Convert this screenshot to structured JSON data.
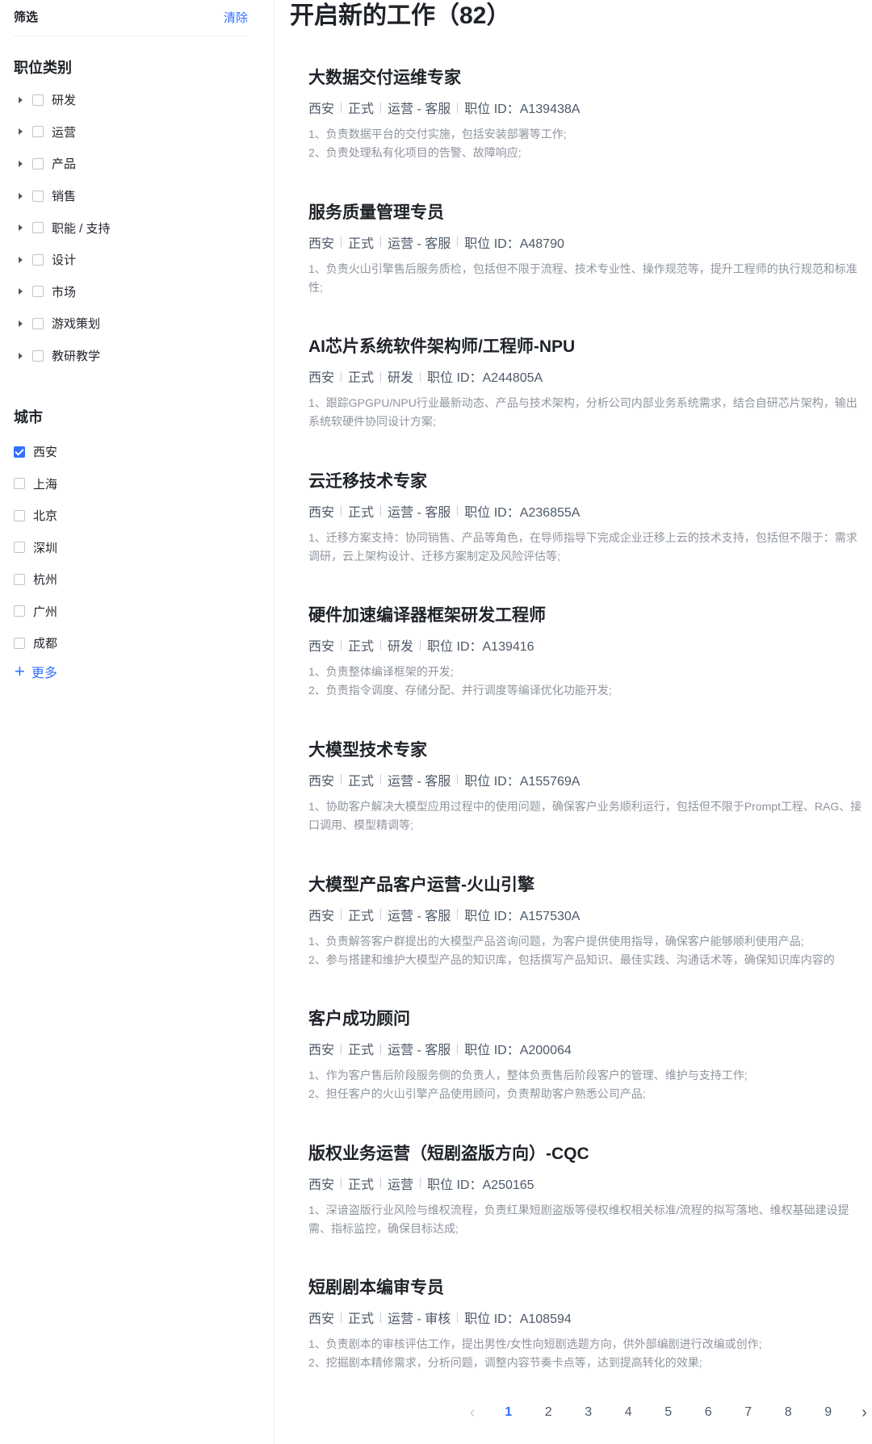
{
  "filter": {
    "title": "筛选",
    "clear": "清除"
  },
  "category": {
    "title": "职位类别",
    "items": [
      {
        "label": "研发"
      },
      {
        "label": "运营"
      },
      {
        "label": "产品"
      },
      {
        "label": "销售"
      },
      {
        "label": "职能 / 支持"
      },
      {
        "label": "设计"
      },
      {
        "label": "市场"
      },
      {
        "label": "游戏策划"
      },
      {
        "label": "教研教学"
      }
    ]
  },
  "city": {
    "title": "城市",
    "items": [
      {
        "label": "西安",
        "checked": true
      },
      {
        "label": "上海",
        "checked": false
      },
      {
        "label": "北京",
        "checked": false
      },
      {
        "label": "深圳",
        "checked": false
      },
      {
        "label": "杭州",
        "checked": false
      },
      {
        "label": "广州",
        "checked": false
      },
      {
        "label": "成都",
        "checked": false
      }
    ],
    "more": "更多"
  },
  "main": {
    "title": "开启新的工作（82）",
    "jobs": [
      {
        "title": "大数据交付运维专家",
        "meta": [
          "西安",
          "正式",
          "运营 - 客服",
          "职位 ID：A139438A"
        ],
        "desc": "1、负责数据平台的交付实施，包括安装部署等工作;\n2、负责处理私有化项目的告警、故障响应;"
      },
      {
        "title": "服务质量管理专员",
        "meta": [
          "西安",
          "正式",
          "运营 - 客服",
          "职位 ID：A48790"
        ],
        "desc": "1、负责火山引擎售后服务质检，包括但不限于流程、技术专业性、操作规范等，提升工程师的执行规范和标准性;"
      },
      {
        "title": "AI芯片系统软件架构师/工程师-NPU",
        "meta": [
          "西安",
          "正式",
          "研发",
          "职位 ID：A244805A"
        ],
        "desc": "1、跟踪GPGPU/NPU行业最新动态、产品与技术架构，分析公司内部业务系统需求，结合自研芯片架构，输出系统软硬件协同设计方案;"
      },
      {
        "title": "云迁移技术专家",
        "meta": [
          "西安",
          "正式",
          "运营 - 客服",
          "职位 ID：A236855A"
        ],
        "desc": "1、迁移方案支持：协同销售、产品等角色，在导师指导下完成企业迁移上云的技术支持，包括但不限于：需求调研，云上架构设计、迁移方案制定及风险评估等;"
      },
      {
        "title": "硬件加速编译器框架研发工程师",
        "meta": [
          "西安",
          "正式",
          "研发",
          "职位 ID：A139416"
        ],
        "desc": "1、负责整体编译框架的开发;\n2、负责指令调度、存储分配、并行调度等编译优化功能开发;"
      },
      {
        "title": "大模型技术专家",
        "meta": [
          "西安",
          "正式",
          "运营 - 客服",
          "职位 ID：A155769A"
        ],
        "desc": "1、协助客户解决大模型应用过程中的使用问题，确保客户业务顺利运行，包括但不限于Prompt工程、RAG、接口调用、模型精调等;"
      },
      {
        "title": "大模型产品客户运营-火山引擎",
        "meta": [
          "西安",
          "正式",
          "运营 - 客服",
          "职位 ID：A157530A"
        ],
        "desc": "1、负责解答客户群提出的大模型产品咨询问题，为客户提供使用指导，确保客户能够顺利使用产品;\n2、参与搭建和维护大模型产品的知识库，包括撰写产品知识、最佳实践、沟通话术等，确保知识库内容的"
      },
      {
        "title": "客户成功顾问",
        "meta": [
          "西安",
          "正式",
          "运营 - 客服",
          "职位 ID：A200064"
        ],
        "desc": "1、作为客户售后阶段服务侧的负责人，整体负责售后阶段客户的管理、维护与支持工作;\n2、担任客户的火山引擎产品使用顾问，负责帮助客户熟悉公司产品;"
      },
      {
        "title": "版权业务运营（短剧盗版方向）-CQC",
        "meta": [
          "西安",
          "正式",
          "运营",
          "职位 ID：A250165"
        ],
        "desc": "1、深谙盗版行业风险与维权流程，负责红果短剧盗版等侵权维权相关标准/流程的拟写落地、维权基础建设提需、指标监控，确保目标达成;"
      },
      {
        "title": "短剧剧本编审专员",
        "meta": [
          "西安",
          "正式",
          "运营 - 审核",
          "职位 ID：A108594"
        ],
        "desc": "1、负责剧本的审核评估工作，提出男性/女性向短剧选题方向，供外部编剧进行改编或创作;\n2、挖掘剧本精修需求，分析问题，调整内容节奏卡点等，达到提高转化的效果;"
      }
    ]
  },
  "pagination": {
    "prev": "‹",
    "next": "›",
    "pages": [
      "1",
      "2",
      "3",
      "4",
      "5",
      "6",
      "7",
      "8",
      "9"
    ],
    "active": "1"
  }
}
